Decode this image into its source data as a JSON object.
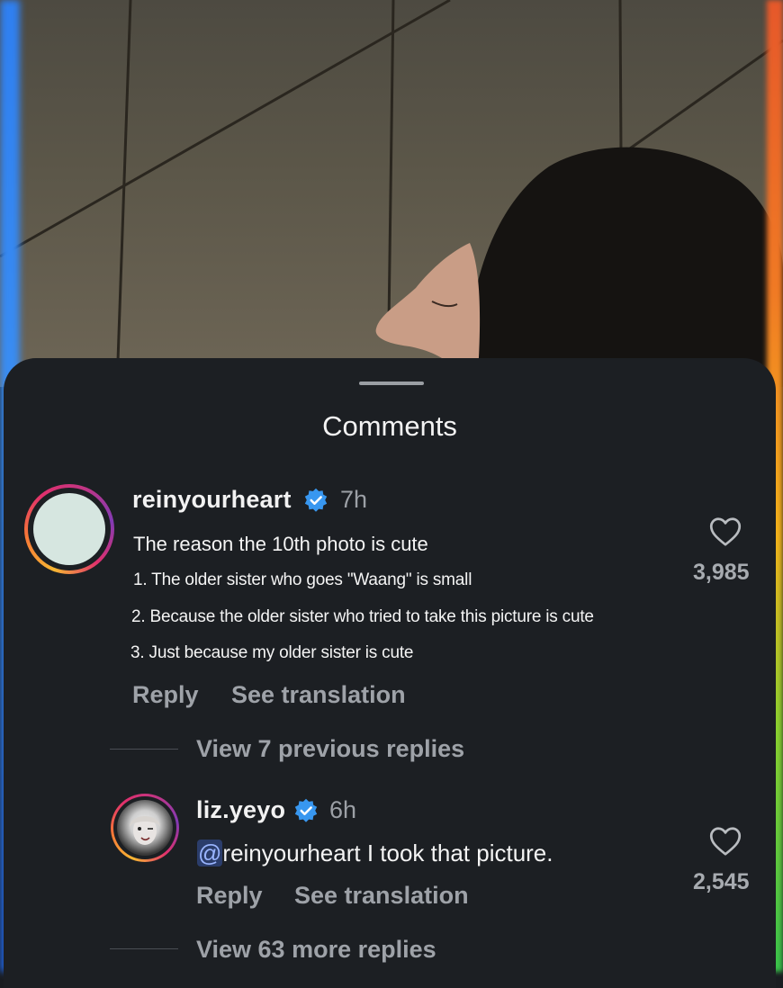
{
  "sheet": {
    "title": "Comments"
  },
  "comments": [
    {
      "username": "reinyourheart",
      "time": "7h",
      "lines": [
        "The reason the 10th photo is cute",
        "1. The older sister who goes \"Waang\" is small",
        "2. Because the older sister who tried to take this picture is cute",
        "3. Just because my older sister is cute"
      ],
      "reply_label": "Reply",
      "translate_label": "See translation",
      "likes": "3,985",
      "view_replies": "View 7 previous replies"
    },
    {
      "username": "liz.yeyo",
      "time": "6h",
      "mention_at": "@",
      "text": "reinyourheart I took that picture.",
      "reply_label": "Reply",
      "translate_label": "See translation",
      "likes": "2,545",
      "view_replies": "View 63 more replies"
    }
  ],
  "colors": {
    "verified": "#3897f0",
    "sheet_bg": "#1c1f23",
    "secondary_text": "#9ea2a8"
  },
  "icons": [
    "verified-badge-icon",
    "heart-icon"
  ]
}
